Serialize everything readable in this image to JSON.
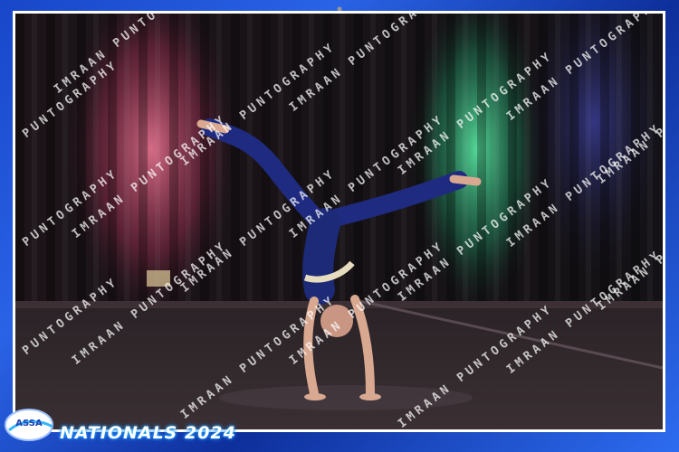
{
  "watermark_text": "IMRAAN PUNTOGRAPHY",
  "footer": {
    "title": "NATIONALS 2024",
    "logo_text": "ASSA"
  },
  "colors": {
    "frame_blue": "#1846c9",
    "stage_red_light": "#d05a7a",
    "stage_green_light": "#3fd28a",
    "costume_navy": "#1c2a78",
    "title_glow": "#2ec3ff"
  }
}
